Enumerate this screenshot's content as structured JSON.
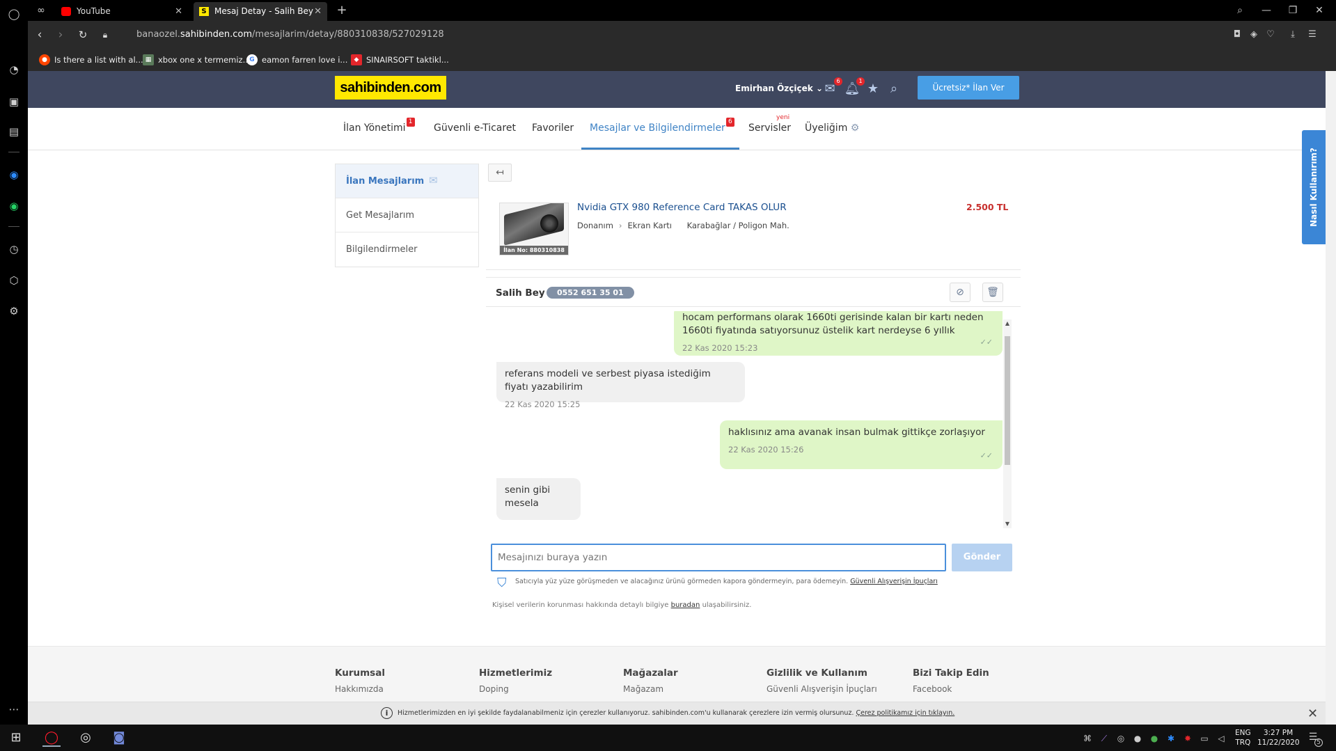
{
  "browser": {
    "tabs": [
      {
        "title": "YouTube"
      },
      {
        "title": "Mesaj Detay - Salih Bey"
      }
    ],
    "url_prefix": "banaozel.",
    "url_domain": "sahibinden.com",
    "url_path": "/mesajlarim/detay/880310838/527029128",
    "bookmarks": [
      {
        "label": "Is there a list with al..."
      },
      {
        "label": "xbox one x termemiz..."
      },
      {
        "label": "eamon farren love i..."
      },
      {
        "label": "SINAIRSOFT taktikl..."
      }
    ]
  },
  "header": {
    "logo": "sahibinden.com",
    "user_name": "Emirhan Özçiçek",
    "messages_badge": "6",
    "notifications_badge": "1",
    "post_button": "Ücretsiz* İlan Ver"
  },
  "nav": {
    "items": [
      {
        "label": "İlan Yönetimi",
        "badge": "1"
      },
      {
        "label": "Güvenli e-Ticaret"
      },
      {
        "label": "Favoriler"
      },
      {
        "label": "Mesajlar ve Bilgilendirmeler",
        "badge": "6"
      },
      {
        "label": "Servisler"
      },
      {
        "label": "Üyeliğim"
      }
    ],
    "new_label": "yeni"
  },
  "help_tab": "Nasıl Kullanırım?",
  "left_menu": {
    "items": [
      {
        "label": "İlan Mesajlarım"
      },
      {
        "label": "Get Mesajlarım"
      },
      {
        "label": "Bilgilendirmeler"
      }
    ]
  },
  "listing": {
    "title": "Nvidia GTX 980 Reference Card TAKAS OLUR",
    "category": "Donanım",
    "subcategory": "Ekran Kartı",
    "location": "Karabağlar / Poligon Mah.",
    "price": "2.500 TL",
    "ilan_no": "İlan No: 880310838"
  },
  "conversation": {
    "name": "Salih Bey",
    "phone": "0552 651 35 01",
    "messages": [
      {
        "text": "hocam performans olarak 1660ti gerisinde kalan bir kartı neden 1660ti fiyatında satıyorsunuz üstelik kart nerdeyse 6 yıllık",
        "time": "22 Kas 2020 15:23",
        "dir": "out"
      },
      {
        "text": "referans modeli ve serbest piyasa istediğim fiyatı yazabilirim",
        "time": "22 Kas 2020 15:25",
        "dir": "in"
      },
      {
        "text": "haklısınız ama avanak insan bulmak gittikçe zorlaşıyor",
        "time": "22 Kas 2020 15:26",
        "dir": "out"
      },
      {
        "text": "senin gibi mesela",
        "dir": "in"
      }
    ],
    "input_placeholder": "Mesajınızı buraya yazın",
    "send_button": "Gönder",
    "safety_text": "Satıcıyla yüz yüze görüşmeden ve alacağınız ürünü görmeden kapora göndermeyin, para ödemeyin.",
    "safety_link": "Güvenli Alışverişin İpuçları"
  },
  "privacy": {
    "before": "Kişisel verilerin korunması hakkında detaylı bilgiye",
    "link": "buradan",
    "after": "ulaşabilirsiniz."
  },
  "footer": {
    "columns": [
      {
        "heading": "Kurumsal",
        "link": "Hakkımızda"
      },
      {
        "heading": "Hizmetlerimiz",
        "link": "Doping"
      },
      {
        "heading": "Mağazalar",
        "link": "Mağazam"
      },
      {
        "heading": "Gizlilik ve Kullanım",
        "link": "Güvenli Alışverişin İpuçları"
      },
      {
        "heading": "Bizi Takip Edin",
        "link": "Facebook"
      }
    ]
  },
  "cookie": {
    "text": "Hizmetlerimizden en iyi şekilde faydalanabilmeniz için çerezler kullanıyoruz. sahibinden.com'u kullanarak çerezlere izin vermiş olursunuz.",
    "link": "Çerez politikamız için tıklayın."
  },
  "taskbar": {
    "lang_top": "ENG",
    "lang_bottom": "TRQ",
    "time": "3:27 PM",
    "date": "11/22/2020",
    "notif_count": "5"
  },
  "colors": {
    "header_bg": "#3f475f",
    "logo_bg": "#ffe800",
    "accent_blue": "#3f83c5",
    "price_red": "#c8302e",
    "out_bubble": "#dff6c7"
  }
}
